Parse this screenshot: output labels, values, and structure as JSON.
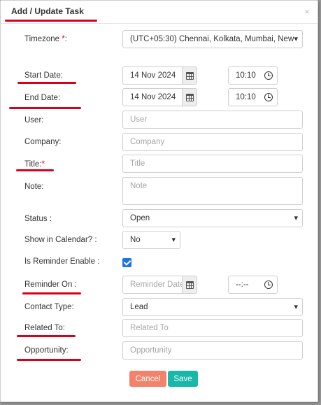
{
  "modal": {
    "title": "Add / Update Task",
    "close_symbol": "×"
  },
  "form": {
    "timezone": {
      "label": "Timezone ",
      "required": "*",
      "suffix": ":",
      "value": "(UTC+05:30) Chennai, Kolkata, Mumbai, New"
    },
    "start_date": {
      "label": "Start Date:",
      "date": "14 Nov 2024",
      "time": "10:10"
    },
    "end_date": {
      "label": "End Date:",
      "date": "14 Nov 2024",
      "time": "10:10"
    },
    "user": {
      "label": "User:",
      "placeholder": "User"
    },
    "company": {
      "label": "Company:",
      "placeholder": "Company"
    },
    "title": {
      "label": "Title:",
      "required": "*",
      "placeholder": "Title"
    },
    "note": {
      "label": "Note:",
      "placeholder": "Note"
    },
    "status": {
      "label": "Status :",
      "value": "Open"
    },
    "show_in_calendar": {
      "label": "Show in Calendar? :",
      "value": "No"
    },
    "is_reminder_enable": {
      "label": "Is Reminder Enable :",
      "checked": true
    },
    "reminder_on": {
      "label": "Reminder On :",
      "date_placeholder": "Reminder Date",
      "time_placeholder": "--:--"
    },
    "contact_type": {
      "label": "Contact Type:",
      "value": "Lead"
    },
    "related_to": {
      "label": "Related To:",
      "placeholder": "Related To"
    },
    "opportunity": {
      "label": "Opportunity:",
      "placeholder": "Opportunity"
    }
  },
  "buttons": {
    "cancel": "Cancel",
    "save": "Save"
  },
  "colors": {
    "annotation_red": "#d9001b",
    "cancel_bg": "#f4826b",
    "save_bg": "#1ab6a8",
    "checkbox_blue": "#1a73e8"
  },
  "icons": {
    "calendar": "calendar-icon",
    "clock": "clock-icon",
    "dropdown": "chevron-down-icon",
    "close": "close-icon",
    "checkbox": "check-icon"
  }
}
